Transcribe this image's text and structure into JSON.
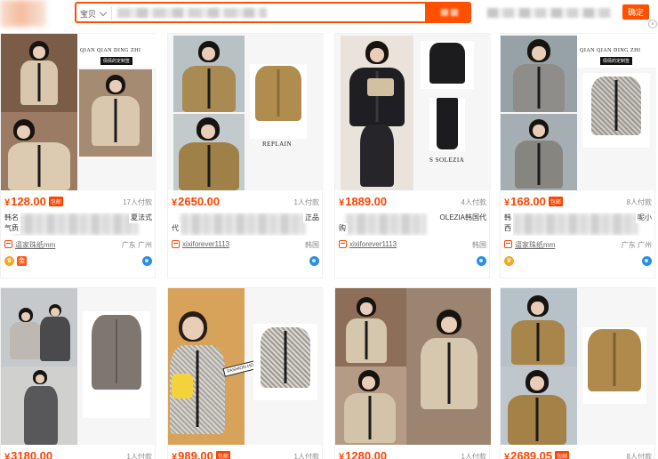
{
  "search": {
    "scope": "宝贝",
    "confirm_label": "确定"
  },
  "products": [
    {
      "price": "128.00",
      "price_badge": "包邮",
      "sold": "17人付款",
      "title_head": "韩名",
      "title_tail": "夏法式",
      "title_line2_head": "气质",
      "shop": "逼家珠纸mm",
      "location": "广东 广州",
      "has_crown": true,
      "has_shop_badge": true,
      "brand_text": "QIAN QIAN DING ZHI",
      "brand_stamp": "倩倩的定制签",
      "colors": {
        "jacket": "#d8c7ad",
        "bg": "#8a6a52"
      }
    },
    {
      "price": "2650.00",
      "price_badge": "",
      "sold": "1人付款",
      "title_head": "",
      "title_tail": "正品",
      "title_line2_head": "代",
      "shop": "xixiforever1113",
      "location": "韩国",
      "has_crown": false,
      "has_shop_badge": false,
      "brand_text": "REPLAIN",
      "brand_stamp": "",
      "colors": {
        "jacket": "#a98a52",
        "bg": "#b9c3c6"
      }
    },
    {
      "price": "1889.00",
      "price_badge": "",
      "sold": "4人付款",
      "title_head": "",
      "title_tail": "OLEZIA韩国代",
      "title_line2_head": "购",
      "shop": "xixiforever1113",
      "location": "韩国",
      "has_crown": false,
      "has_shop_badge": false,
      "brand_text": "S SOLEZIA",
      "brand_stamp": "",
      "colors": {
        "jacket": "#1e1e22",
        "bg": "#efe9e2"
      }
    },
    {
      "price": "168.00",
      "price_badge": "包邮",
      "sold": "8人付款",
      "title_head": "韩",
      "title_tail": "呢小",
      "title_line2_head": "西",
      "shop": "逼家珠纸mm",
      "location": "广东 广州",
      "has_crown": true,
      "has_shop_badge": false,
      "brand_text": "QIAN QIAN DING ZHI",
      "brand_stamp": "倩倩的定制签",
      "colors": {
        "jacket": "#8e8c88",
        "bg": "#9aa4a8"
      }
    },
    {
      "price": "3180.00",
      "price_badge": "",
      "sold": "1人付款",
      "colors": {
        "jacket": "#7a7470",
        "bg": "#c9cccf"
      }
    },
    {
      "price": "989.00",
      "price_badge": "包邮",
      "sold": "1人付款",
      "brand_stamp": "FASHION HOUSE",
      "colors": {
        "jacket": "#b9b6b1",
        "bg": "#d9a55d"
      }
    },
    {
      "price": "1280.00",
      "price_badge": "",
      "sold": "1人付款",
      "colors": {
        "jacket": "#d4c6ad",
        "bg": "#8d6e58"
      }
    },
    {
      "price": "2689.05",
      "price_badge": "包邮",
      "sold": "8人付款",
      "colors": {
        "jacket": "#a7854b",
        "bg": "#b8c2c9"
      }
    }
  ]
}
